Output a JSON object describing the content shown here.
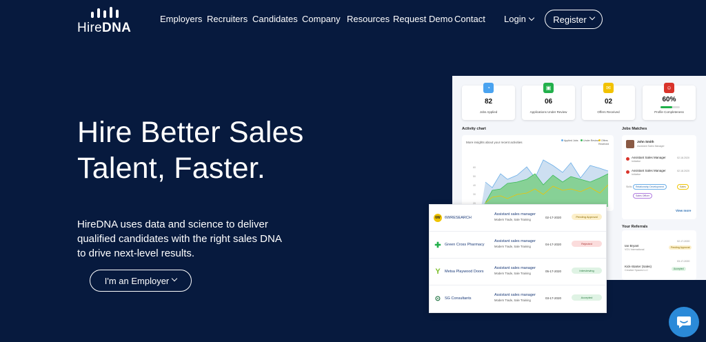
{
  "brand": {
    "name_light": "Hire",
    "name_bold": "DNA"
  },
  "nav": {
    "links": [
      "Employers",
      "Recruiters",
      "Candidates",
      "Company",
      "Resources",
      "Request Demo",
      "Contact"
    ],
    "login": "Login",
    "register": "Register"
  },
  "hero": {
    "title_line1": "Hire Better Sales",
    "title_line2": "Talent, Faster.",
    "description": "HireDNA uses data and science to deliver qualified candidates with the right sales DNA to drive next-level results.",
    "cta": "I'm an Employer"
  },
  "dashboard": {
    "stats": [
      {
        "value": "82",
        "label": "Jobs Applied",
        "color": "#4aa3f0"
      },
      {
        "value": "06",
        "label": "Applications Under Review",
        "color": "#22b04b"
      },
      {
        "value": "02",
        "label": "Offers Received",
        "color": "#f2c200"
      },
      {
        "value": "60%",
        "label": "Profile Completeness",
        "color": "#d9342b",
        "progress": 0.6
      }
    ],
    "activity": {
      "title": "Activity chart",
      "subtitle": "More insights about your recent activities",
      "legend": [
        {
          "label": "Applied Jobs",
          "color": "#6aaee8"
        },
        {
          "label": "Under Review",
          "color": "#3cba5a"
        },
        {
          "label": "Offers Received",
          "color": "#f0c400"
        }
      ]
    },
    "jobs_matches": {
      "title": "Jobs Matches",
      "person_name": "John Smith",
      "person_role": "Assistant Sales Manager",
      "items": [
        {
          "title": "Assistant Sales Manager",
          "sub": "Initiative",
          "date": "02.18.2020"
        },
        {
          "title": "Assistant Sales Manager",
          "sub": "Initiative",
          "date": "02.18.2020"
        }
      ],
      "skills_label": "Skills",
      "skills": [
        "Relationship Development",
        "Sales",
        "Sales Officer"
      ],
      "view_more": "View more"
    },
    "referrals": {
      "title": "Your Referrals",
      "items": [
        {
          "name": "Ian Bryant",
          "company": "VOV International",
          "date": "02-17-2020",
          "status": "Pending Approval"
        },
        {
          "name": "Kick-Starter (Sales)",
          "company": "Creative Spaces LLC",
          "date": "03-17-2020",
          "status": "Accepted"
        }
      ]
    }
  },
  "applications": [
    {
      "company": "6WRESEARCH",
      "logo": "6W",
      "job": "Assistant sales manager",
      "sub": "Modern Trade, Sale Training",
      "date": "02-17-2020",
      "status": "Pending Approval",
      "status_bg": "#fcefc9",
      "status_fg": "#8a6a00"
    },
    {
      "company": "Green Cross Pharmacy",
      "logo": "✚",
      "job": "Assistant sales manager",
      "sub": "Modern Trade, Sale Training",
      "date": "04-17-2020",
      "status": "Rejected",
      "status_bg": "#fbdcdc",
      "status_fg": "#a33"
    },
    {
      "company": "Metsa Playwood Doors",
      "logo": "Y",
      "job": "Assistant sales manager",
      "sub": "Modern Trade, Sale Training",
      "date": "05-17-2020",
      "status": "Interviewing",
      "status_bg": "#dff3e4",
      "status_fg": "#267a3e"
    },
    {
      "company": "SG Consultants",
      "logo": "⊙",
      "job": "Assistant sales manager",
      "sub": "Modern Trade, Sale Training",
      "date": "03-17-2020",
      "status": "Accepted",
      "status_bg": "#dff3e4",
      "status_fg": "#267a3e"
    }
  ]
}
